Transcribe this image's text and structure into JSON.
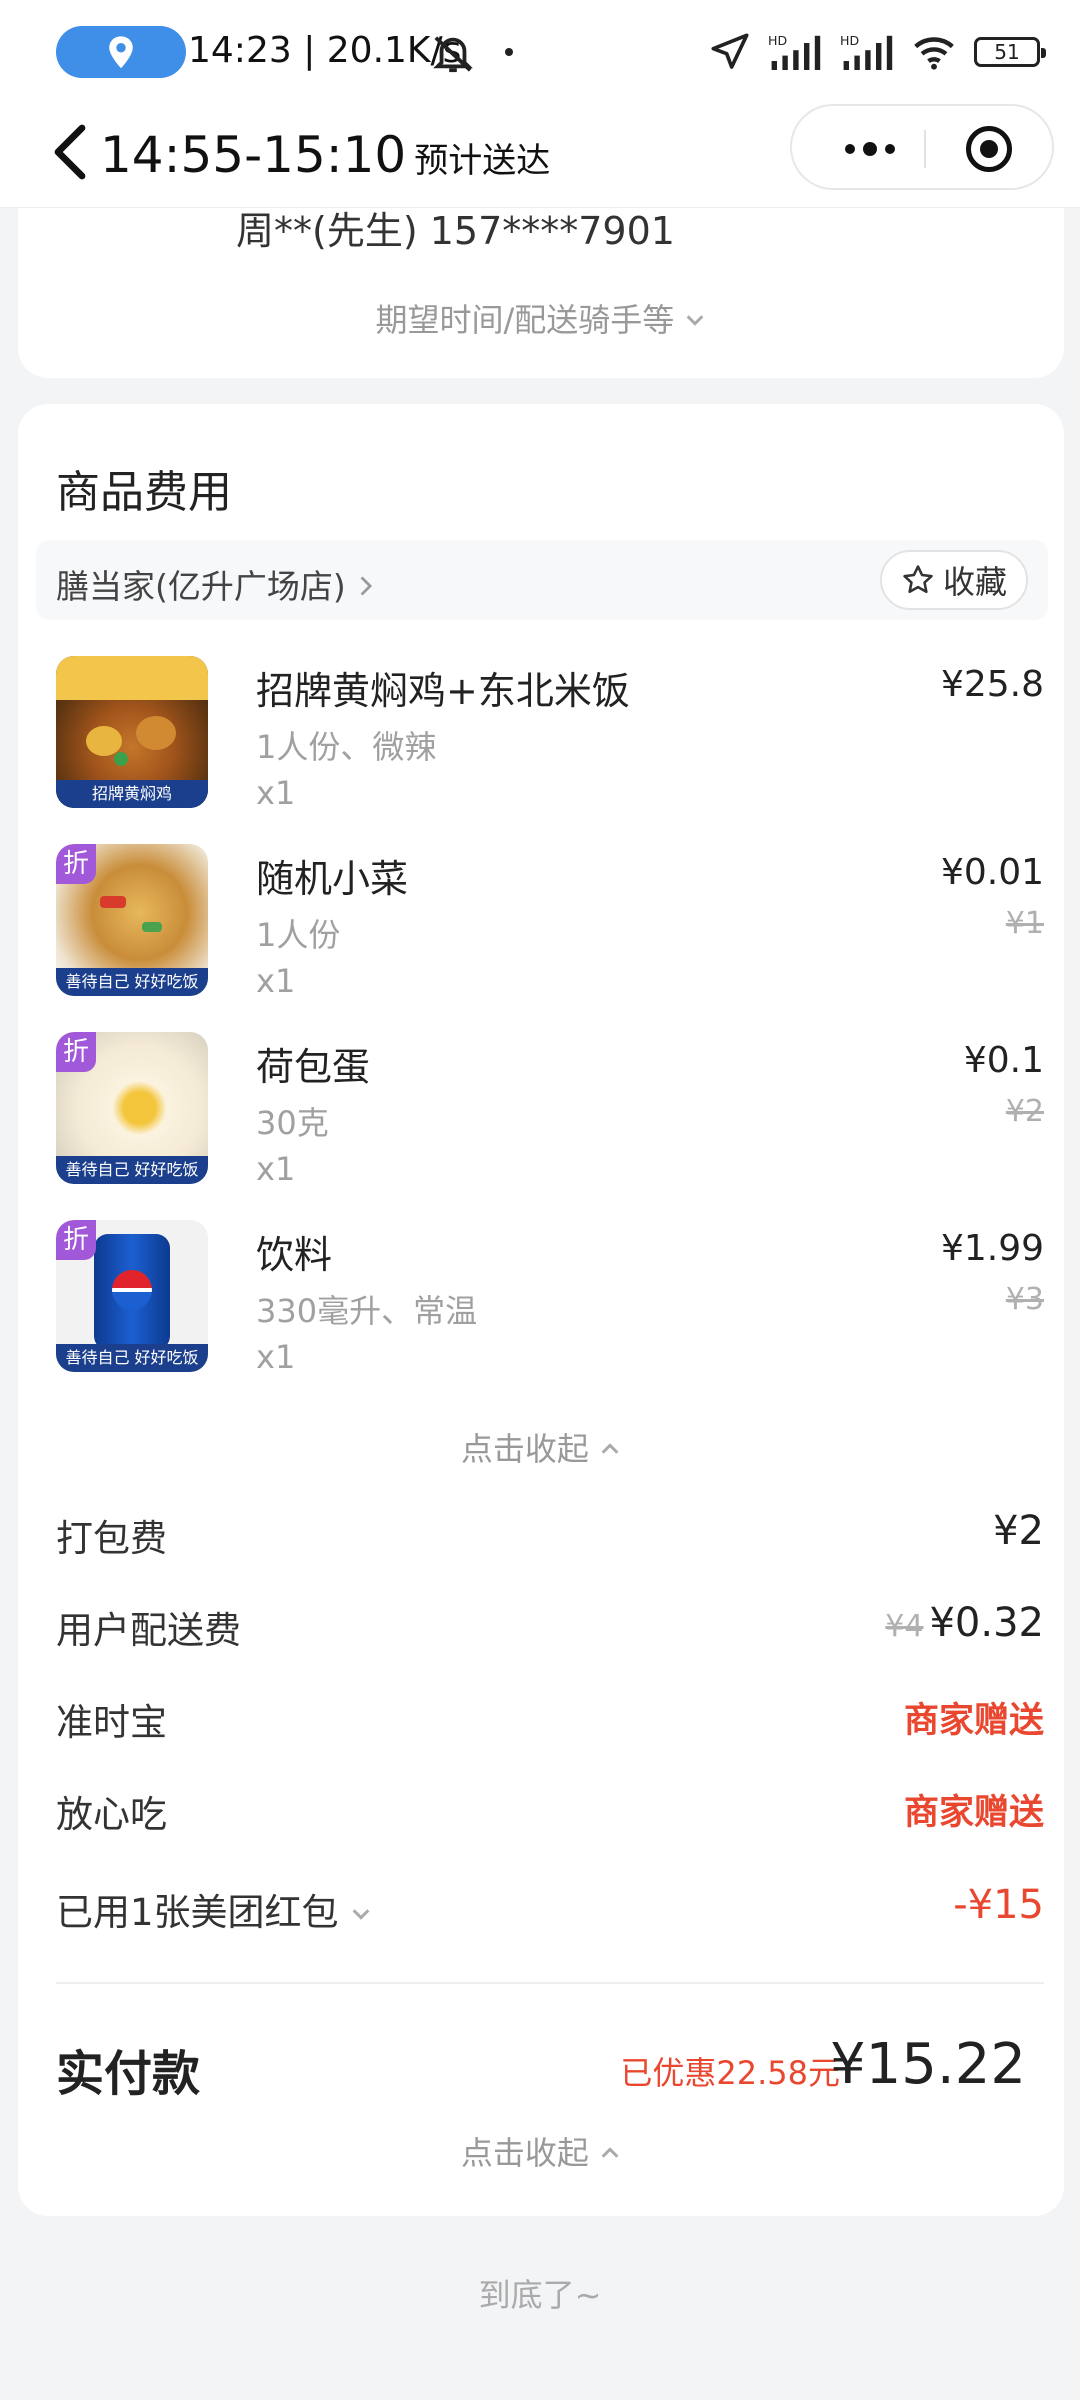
{
  "status_bar": {
    "time_speed": "14:23 | 20.1K/s",
    "battery": "51"
  },
  "header": {
    "eta": "14:55-15:10",
    "eta_suffix": "预计送达"
  },
  "address": {
    "contact": "周**(先生) 157****7901",
    "expect_link": "期望时间/配送骑手等"
  },
  "goods": {
    "title": "商品费用",
    "shop_name": "膳当家(亿升广场店)",
    "favorite_label": "收藏",
    "items": [
      {
        "name": "招牌黄焖鸡+东北米饭",
        "spec": "1人份、微辣",
        "qty": "x1",
        "price": "¥25.8",
        "orig": "",
        "discount": false,
        "band": "招牌黄焖鸡"
      },
      {
        "name": "随机小菜",
        "spec": "1人份",
        "qty": "x1",
        "price": "¥0.01",
        "orig": "¥1",
        "discount": true,
        "band": "善待自己 好好吃饭"
      },
      {
        "name": "荷包蛋",
        "spec": "30克",
        "qty": "x1",
        "price": "¥0.1",
        "orig": "¥2",
        "discount": true,
        "band": "善待自己 好好吃饭"
      },
      {
        "name": "饮料",
        "spec": "330毫升、常温",
        "qty": "x1",
        "price": "¥1.99",
        "orig": "¥3",
        "discount": true,
        "band": "善待自己 好好吃饭"
      }
    ],
    "discount_tag": "折",
    "collapse_label": "点击收起"
  },
  "fees": {
    "packing_label": "打包费",
    "packing_value": "¥2",
    "delivery_label": "用户配送费",
    "delivery_orig": "¥4",
    "delivery_value": "¥0.32",
    "ontime_label": "准时宝",
    "ontime_value": "商家赠送",
    "safe_label": "放心吃",
    "safe_value": "商家赠送",
    "coupon_label": "已用1张美团红包",
    "coupon_value": "-¥15"
  },
  "total": {
    "label": "实付款",
    "saved": "已优惠22.58元",
    "amount": "¥15.22",
    "collapse_label": "点击收起"
  },
  "footer": {
    "end_note": "到底了~"
  },
  "colors": {
    "accent_red": "#e9472f",
    "discount_purple": "#a259d9",
    "location_blue": "#3f8ee8"
  }
}
